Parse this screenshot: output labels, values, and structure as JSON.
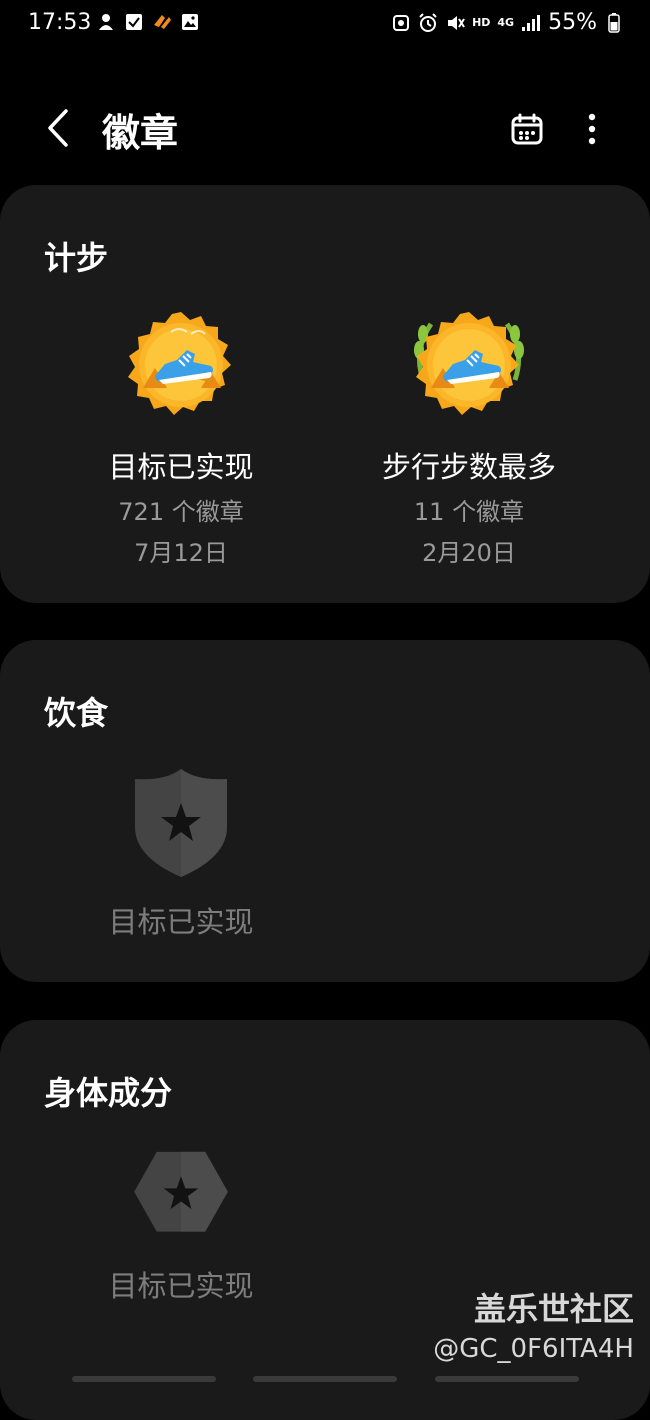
{
  "status_bar": {
    "time": "17:53",
    "hd": "HD",
    "network": "4G",
    "battery": "55%",
    "left_icons": [
      "notification-icon",
      "checkbox-icon",
      "app-icon",
      "gallery-icon"
    ],
    "right_icons": [
      "sync-icon",
      "alarm-icon",
      "mute-icon",
      "signal-icon",
      "battery-icon"
    ]
  },
  "header": {
    "title": "徽章"
  },
  "sections": [
    {
      "title": "计步",
      "badges": [
        {
          "name": "目标已实现",
          "count": "721 个徽章",
          "date": "7月12日",
          "icon": "running-shoe-gold-badge-icon"
        },
        {
          "name": "步行步数最多",
          "count": "11 个徽章",
          "date": "2月20日",
          "icon": "running-shoe-laurel-badge-icon"
        }
      ]
    },
    {
      "title": "饮食",
      "badges": [
        {
          "name": "目标已实现",
          "icon": "shield-star-locked-icon"
        }
      ]
    },
    {
      "title": "身体成分",
      "badges": [
        {
          "name": "目标已实现",
          "icon": "hexagon-star-locked-icon"
        }
      ]
    }
  ],
  "watermark": {
    "site": "盖乐世社区",
    "user": "@GC_0F6ITA4H"
  },
  "colors": {
    "background": "#000000",
    "card": "#1a1a1a",
    "badge_gold": "#f6a81a",
    "shoe_blue": "#3aa0e8",
    "locked_gray": "#444444"
  }
}
